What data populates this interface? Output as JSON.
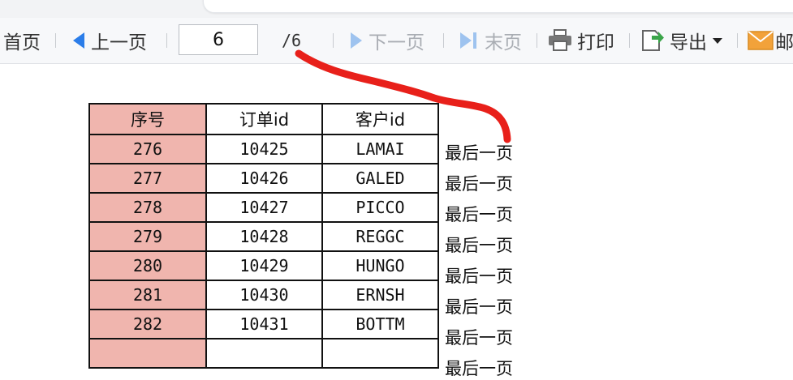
{
  "toolbar": {
    "first_label": "首页",
    "prev_label": "上一页",
    "page_value": "6",
    "page_total": "/6",
    "next_label": "下一页",
    "last_label": "末页",
    "print_label": "打印",
    "export_label": "导出",
    "mail_label": "邮"
  },
  "table": {
    "headers": [
      "序号",
      "订单id",
      "客户id"
    ],
    "rows": [
      [
        "276",
        "10425",
        "LAMAI"
      ],
      [
        "277",
        "10426",
        "GALED"
      ],
      [
        "278",
        "10427",
        "PICCO"
      ],
      [
        "279",
        "10428",
        "REGGC"
      ],
      [
        "280",
        "10429",
        "HUNGO"
      ],
      [
        "281",
        "10430",
        "ERNSH"
      ],
      [
        "282",
        "10431",
        "BOTTM"
      ]
    ],
    "side_label": "最后一页"
  },
  "colors": {
    "index_col": "#f0b5ae",
    "accent_blue": "#2b7de9",
    "annotation_red": "#e8201a"
  }
}
